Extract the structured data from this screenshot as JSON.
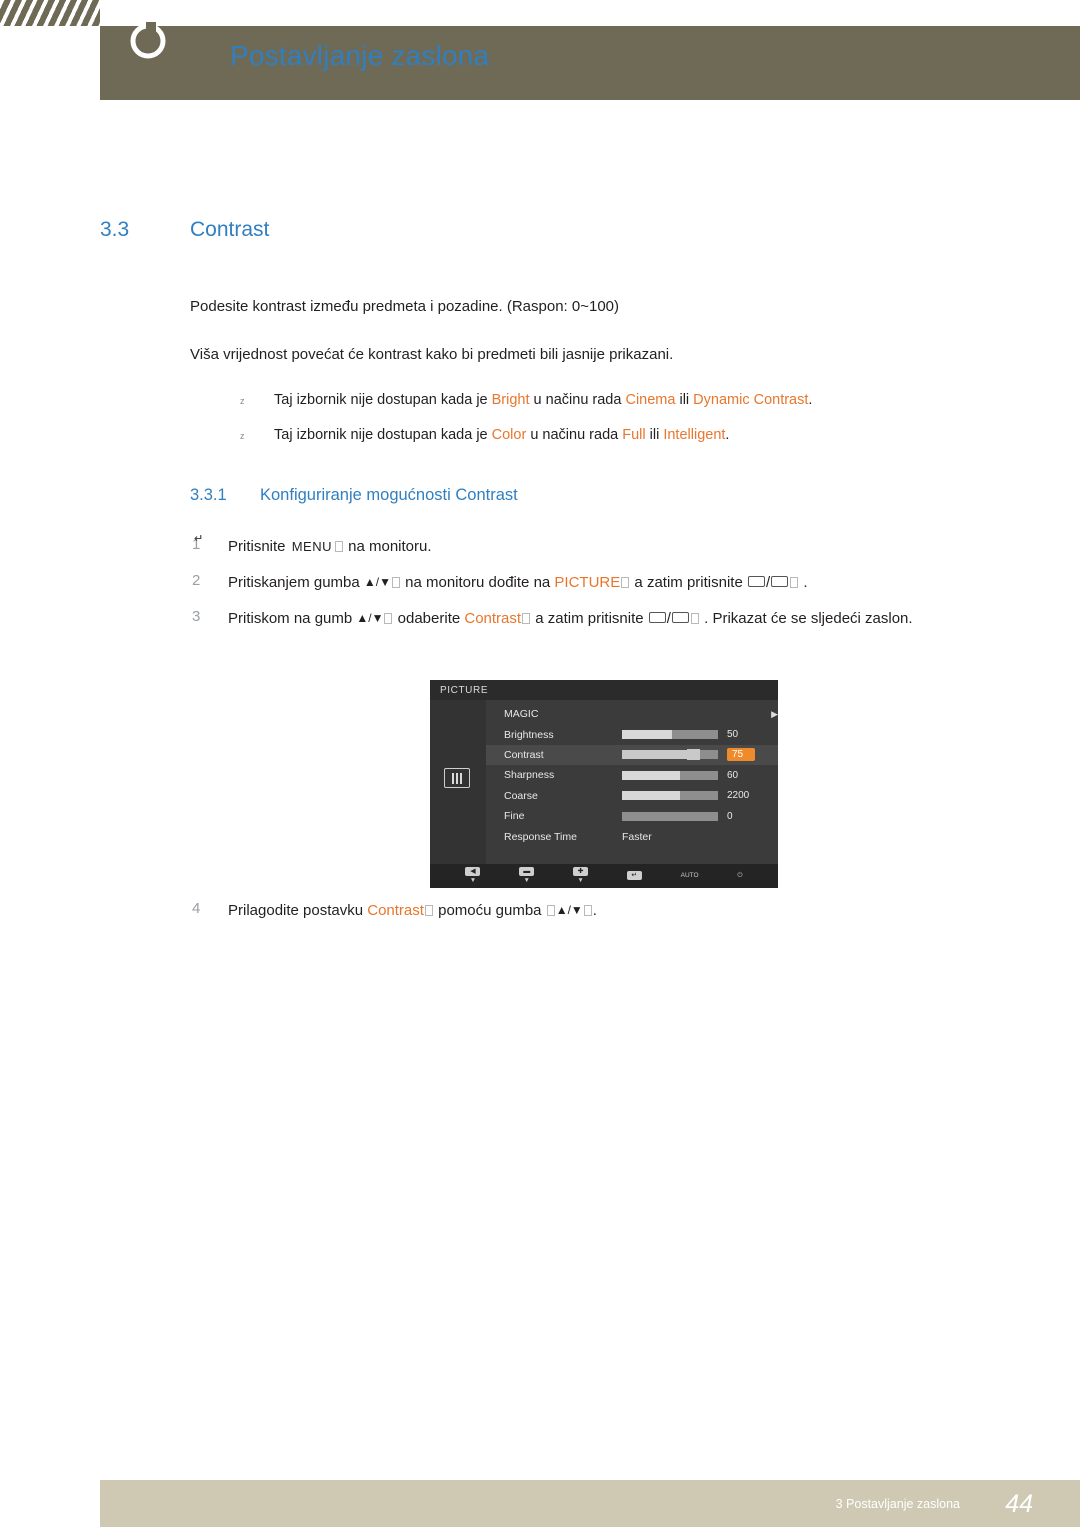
{
  "header": {
    "title": "Postavljanje zaslona",
    "glyph_icon": "circle-glyph"
  },
  "section": {
    "number": "3.3",
    "title": "Contrast"
  },
  "paragraphs": {
    "p1": "Podesite kontrast između predmeta i pozadine. (Raspon: 0~100)",
    "p2": "Viša vrijednost povećat će kontrast kako bi predmeti bili jasnije prikazani."
  },
  "notes": [
    {
      "bullet": "z",
      "pre": "Taj izbornik nije dostupan kada je ",
      "kw1": "Bright",
      "mid1": " u načinu rada ",
      "kw2": "Cinema",
      "mid2": " ili ",
      "kw3": "Dynamic Contrast",
      "post": "."
    },
    {
      "bullet": "z",
      "pre": "Taj izbornik nije dostupan kada je ",
      "kw1": "Color",
      "mid1": " u načinu rada ",
      "kw2": "Full",
      "mid2": " ili ",
      "kw3": "Intelligent",
      "post": "."
    }
  ],
  "subsection": {
    "number": "3.3.1",
    "title": "Konfiguriranje mogućnosti Contrast"
  },
  "steps": [
    {
      "num": "1",
      "t1": "Pritisnite ",
      "key": "MENU",
      "t2": " na monitoru."
    },
    {
      "num": "2",
      "t1": "Pritiskanjem gumba ",
      "key": "▲/▼",
      "t2": " na monitoru dođite na ",
      "kw": "PICTURE",
      "t3": " a zatim pritisnite ",
      "t4": " ."
    },
    {
      "num": "3",
      "t1": "Pritiskom na gumb ",
      "key": "▲/▼",
      "t2": " odaberite ",
      "kw": "Contrast",
      "t3": " a zatim pritisnite ",
      "t4": " . Prikazat će se sljedeći zaslon."
    }
  ],
  "step4": {
    "num": "4",
    "t1": "Prilagodite postavku ",
    "kw": "Contrast",
    "t2": " pomoću gumba ",
    "key": "▲/▼",
    "t3": "."
  },
  "osd": {
    "title": "PICTURE",
    "icon_name": "picture-icon",
    "rows": [
      {
        "label": "MAGIC",
        "type": "submenu",
        "arrow": "▶"
      },
      {
        "label": "Brightness",
        "type": "slider",
        "value": "50",
        "fill": 52,
        "selected": false
      },
      {
        "label": "Contrast",
        "type": "slider",
        "value": "75",
        "fill": 75,
        "selected": true
      },
      {
        "label": "Sharpness",
        "type": "slider",
        "value": "60",
        "fill": 60,
        "selected": false
      },
      {
        "label": "Coarse",
        "type": "slider",
        "value": "2200",
        "fill": 60,
        "selected": false
      },
      {
        "label": "Fine",
        "type": "slider",
        "value": "0",
        "fill": 0,
        "selected": false
      },
      {
        "label": "Response Time",
        "type": "text",
        "value": "Faster",
        "selected": false
      }
    ],
    "footer": [
      {
        "cap": "◀",
        "lbl": "▼"
      },
      {
        "cap": "▬",
        "lbl": "▼"
      },
      {
        "cap": "✚",
        "lbl": "▼"
      },
      {
        "cap": "↵",
        "lbl": ""
      },
      {
        "cap": "",
        "lbl": "AUTO"
      },
      {
        "cap": "",
        "lbl": "⏻"
      }
    ]
  },
  "footer": {
    "text": "3 Postavljanje zaslona",
    "page": "44"
  },
  "colors": {
    "header_bg": "#6f6a55",
    "accent_blue": "#2f7fc1",
    "accent_orange": "#e8762c",
    "footer_bg": "#cfc9b4",
    "osd_bg": "#3b3b3b",
    "osd_badge": "#f08b2c"
  }
}
